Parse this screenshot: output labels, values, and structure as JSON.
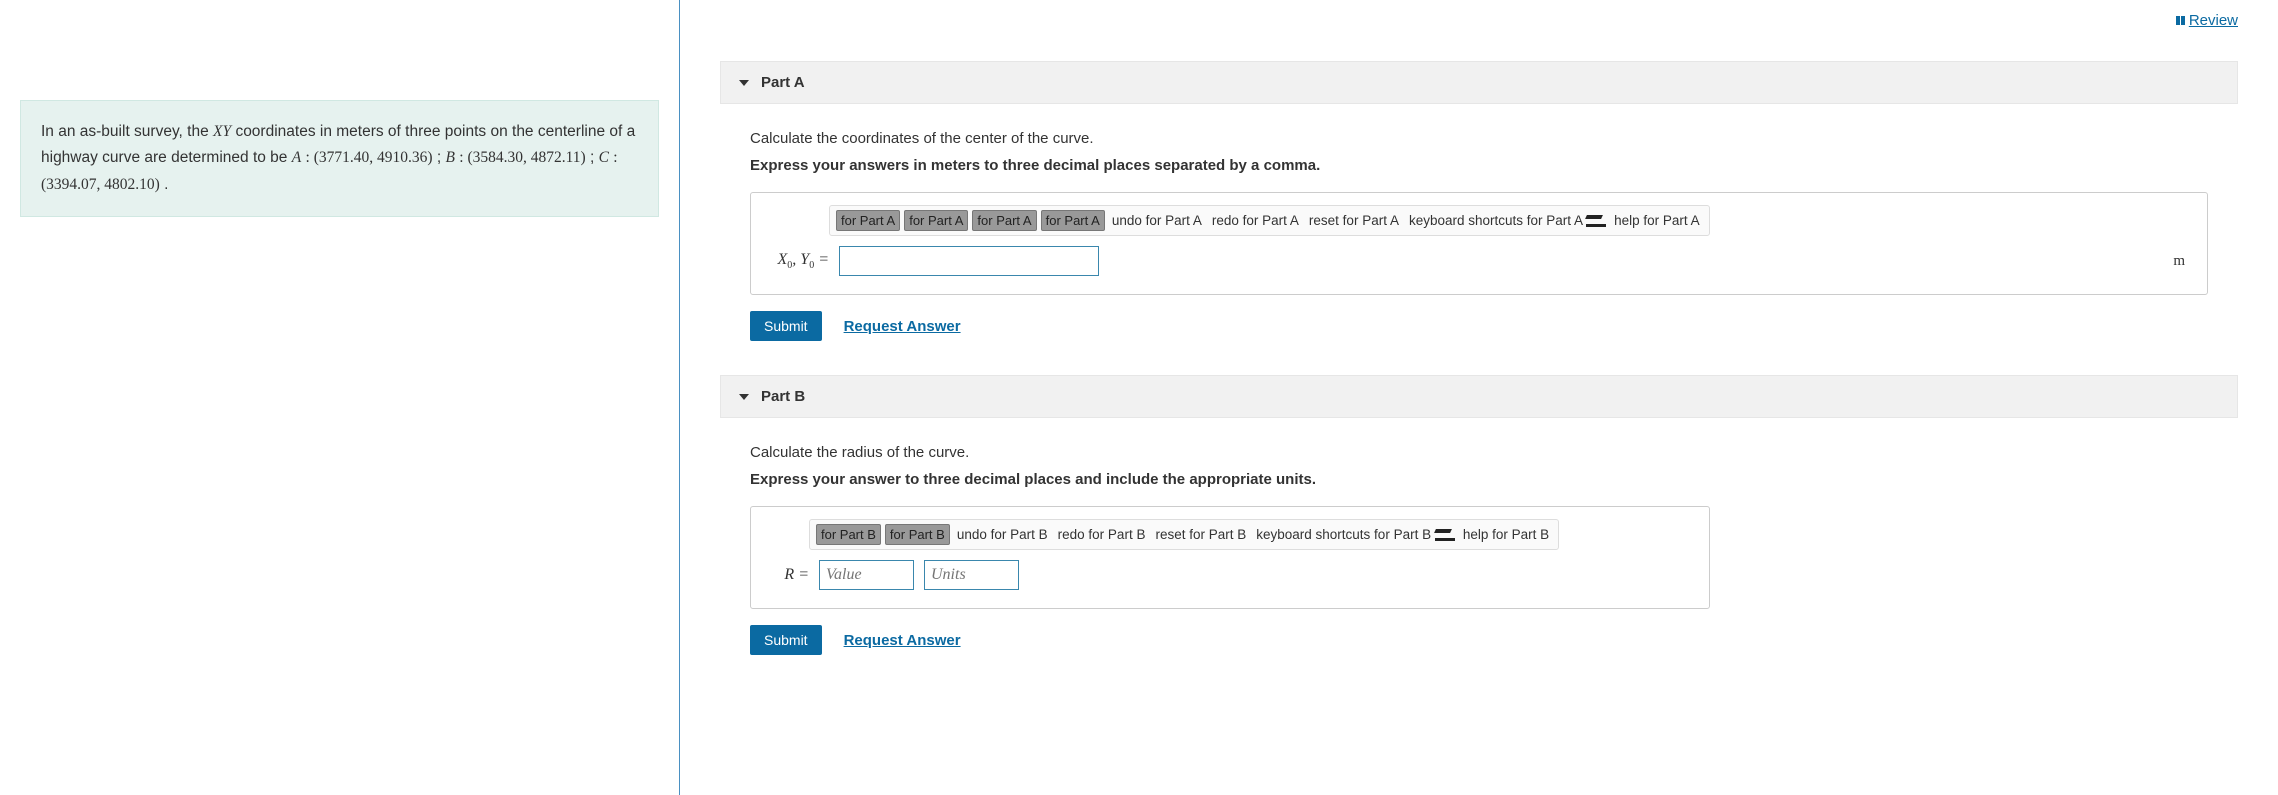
{
  "review_label": "Review",
  "problem": {
    "prefix": "In an as-built survey, the ",
    "xy": "XY",
    "mid1": " coordinates in meters of three points on the centerline of a highway curve are determined to be ",
    "A_label": "A",
    "A_coords": "(3771.40, 4910.36)",
    "sep1": "; ",
    "B_label": "B",
    "B_coords": "(3584.30, 4872.11)",
    "sep2": "; ",
    "C_label": "C",
    "C_coords": "(3394.07, 4802.10)",
    "tail": "."
  },
  "partA": {
    "title": "Part A",
    "instruction": "Calculate the coordinates of the center of the curve.",
    "format": "Express your answers in meters to three decimal places separated by a comma.",
    "toolbar": {
      "b1": "for Part A",
      "b2": "for Part A",
      "b3": "for Part A",
      "b4": "for Part A",
      "undo": "undo for Part A",
      "redo": "redo for Part A",
      "reset": "reset for Part A",
      "keyboard": "keyboard shortcuts for Part A",
      "help": "help for Part A"
    },
    "var_label_html": "X₀, Y₀ =",
    "unit": "m",
    "submit": "Submit",
    "request": "Request Answer"
  },
  "partB": {
    "title": "Part B",
    "instruction": "Calculate the radius of the curve.",
    "format": "Express your answer to three decimal places and include the appropriate units.",
    "toolbar": {
      "b1": "for Part B",
      "b2": "for Part B",
      "undo": "undo for Part B",
      "redo": "redo for Part B",
      "reset": "reset for Part B",
      "keyboard": "keyboard shortcuts for Part B",
      "help": "help for Part B"
    },
    "var_label": "R =",
    "value_placeholder": "Value",
    "units_placeholder": "Units",
    "submit": "Submit",
    "request": "Request Answer"
  }
}
